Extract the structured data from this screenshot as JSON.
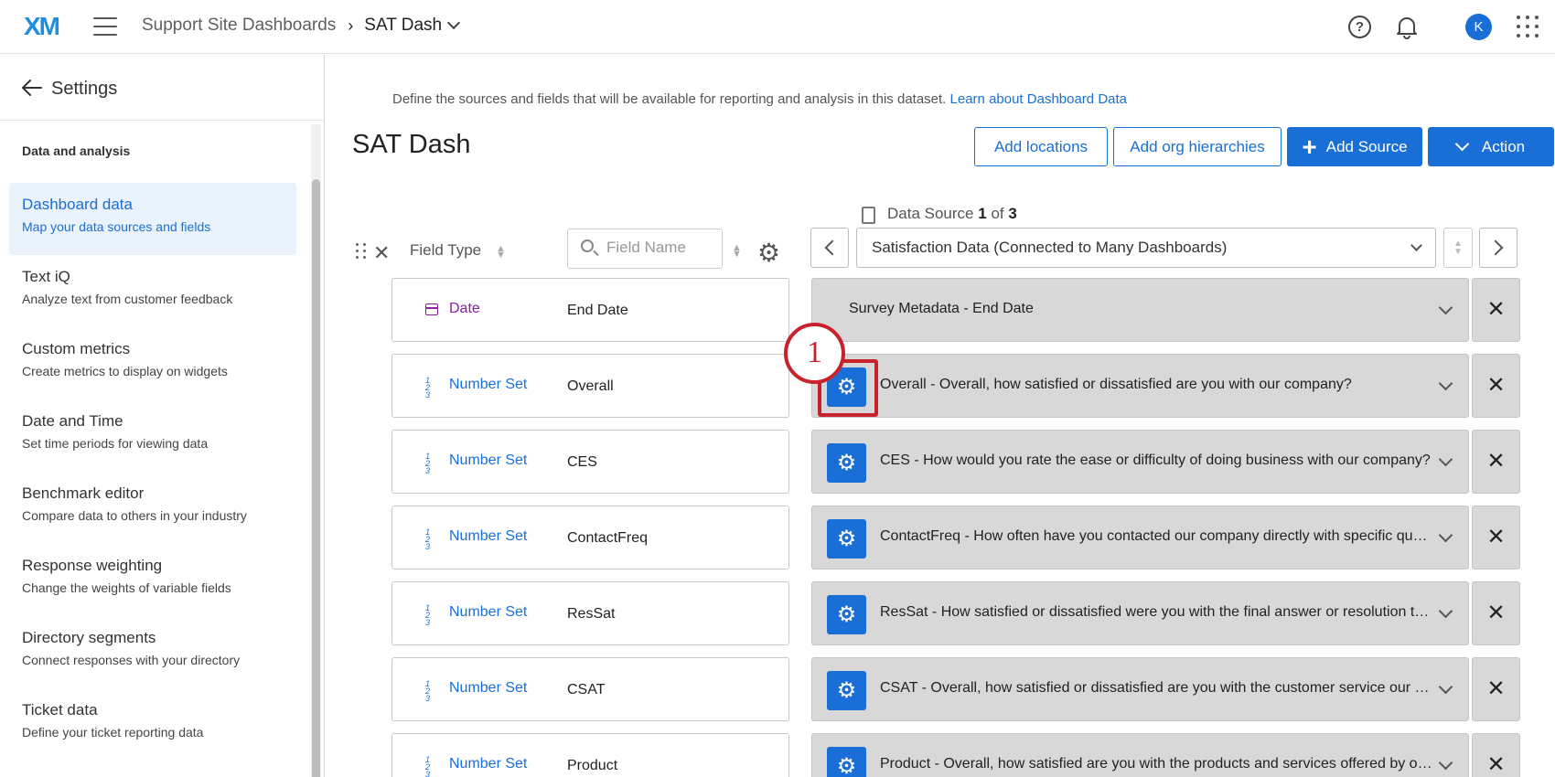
{
  "topbar": {
    "logo": "XM",
    "breadcrumb_parent": "Support Site Dashboards",
    "breadcrumb_sep": "›",
    "breadcrumb_current": "SAT Dash",
    "help_glyph": "?",
    "avatar_initial": "K"
  },
  "sidebar": {
    "title": "Settings",
    "section": "Data and analysis",
    "items": [
      {
        "label": "Dashboard data",
        "sub": "Map your data sources and fields",
        "active": true
      },
      {
        "label": "Text iQ",
        "sub": "Analyze text from customer feedback"
      },
      {
        "label": "Custom metrics",
        "sub": "Create metrics to display on widgets"
      },
      {
        "label": "Date and Time",
        "sub": "Set time periods for viewing data"
      },
      {
        "label": "Benchmark editor",
        "sub": "Compare data to others in your industry"
      },
      {
        "label": "Response weighting",
        "sub": "Change the weights of variable fields"
      },
      {
        "label": "Directory segments",
        "sub": "Connect responses with your directory"
      },
      {
        "label": "Ticket data",
        "sub": "Define your ticket reporting data"
      }
    ]
  },
  "main": {
    "intro": "Define the sources and fields that will be available for reporting and analysis in this dataset.",
    "intro_link": "Learn about Dashboard Data",
    "title": "SAT Dash",
    "buttons": {
      "add_locations": "Add locations",
      "add_org": "Add org hierarchies",
      "add_source": "Add Source",
      "action": "Action"
    },
    "data_source": {
      "prefix": "Data Source",
      "current": "1",
      "of": "of",
      "total": "3"
    },
    "columns": {
      "field_type": "Field Type",
      "field_name_placeholder": "Field Name"
    },
    "source_select": "Satisfaction Data (Connected to Many Dashboards)",
    "rows": [
      {
        "type": "Date",
        "name": "End Date",
        "mapping": "Survey Metadata - End Date"
      },
      {
        "type": "Number Set",
        "name": "Overall",
        "mapping": "Overall - Overall, how satisfied or dissatisfied are you with our company?"
      },
      {
        "type": "Number Set",
        "name": "CES",
        "mapping": "CES - How would you rate the ease or difficulty of doing business with our company?"
      },
      {
        "type": "Number Set",
        "name": "ContactFreq",
        "mapping": "ContactFreq - How often have you contacted our company directly with specific ques..."
      },
      {
        "type": "Number Set",
        "name": "ResSat",
        "mapping": "ResSat - How satisfied or dissatisfied were you with the final answer or resolution to ..."
      },
      {
        "type": "Number Set",
        "name": "CSAT",
        "mapping": "CSAT - Overall, how satisfied or dissatisfied are you with the customer service our co..."
      },
      {
        "type": "Number Set",
        "name": "Product",
        "mapping": "Product - Overall, how satisfied are you with the products and services offered by ou..."
      }
    ],
    "callout_number": "1"
  },
  "colors": {
    "accent": "#1a6fd6",
    "date": "#8a1fa0",
    "callout": "#c8232c",
    "mapping_bg": "#d8d8d8"
  }
}
